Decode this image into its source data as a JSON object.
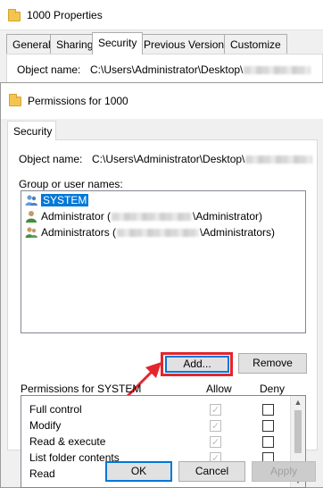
{
  "outer": {
    "title": "1000 Properties",
    "tabs": [
      "General",
      "Sharing",
      "Security",
      "Previous Versions",
      "Customize"
    ],
    "object_label": "Object name:",
    "object_path": "C:\\Users\\Administrator\\Desktop\\"
  },
  "dialog": {
    "title": "Permissions for 1000",
    "tab": "Security",
    "object_label": "Object name:",
    "object_path": "C:\\Users\\Administrator\\Desktop\\",
    "group_label": "Group or user names:",
    "users": [
      {
        "pre": "SYSTEM",
        "post": ""
      },
      {
        "pre": "Administrator (",
        "post": "\\Administrator)"
      },
      {
        "pre": "Administrators (",
        "post": "\\Administrators)"
      }
    ],
    "add_button": "Add...",
    "remove_button": "Remove",
    "permissions_label": "Permissions for SYSTEM",
    "allow_header": "Allow",
    "deny_header": "Deny",
    "permissions": [
      "Full control",
      "Modify",
      "Read & execute",
      "List folder contents",
      "Read"
    ],
    "ok_button": "OK",
    "cancel_button": "Cancel",
    "apply_button": "Apply"
  },
  "colors": {
    "highlight": "#e3262e",
    "selection": "#0078d7"
  }
}
